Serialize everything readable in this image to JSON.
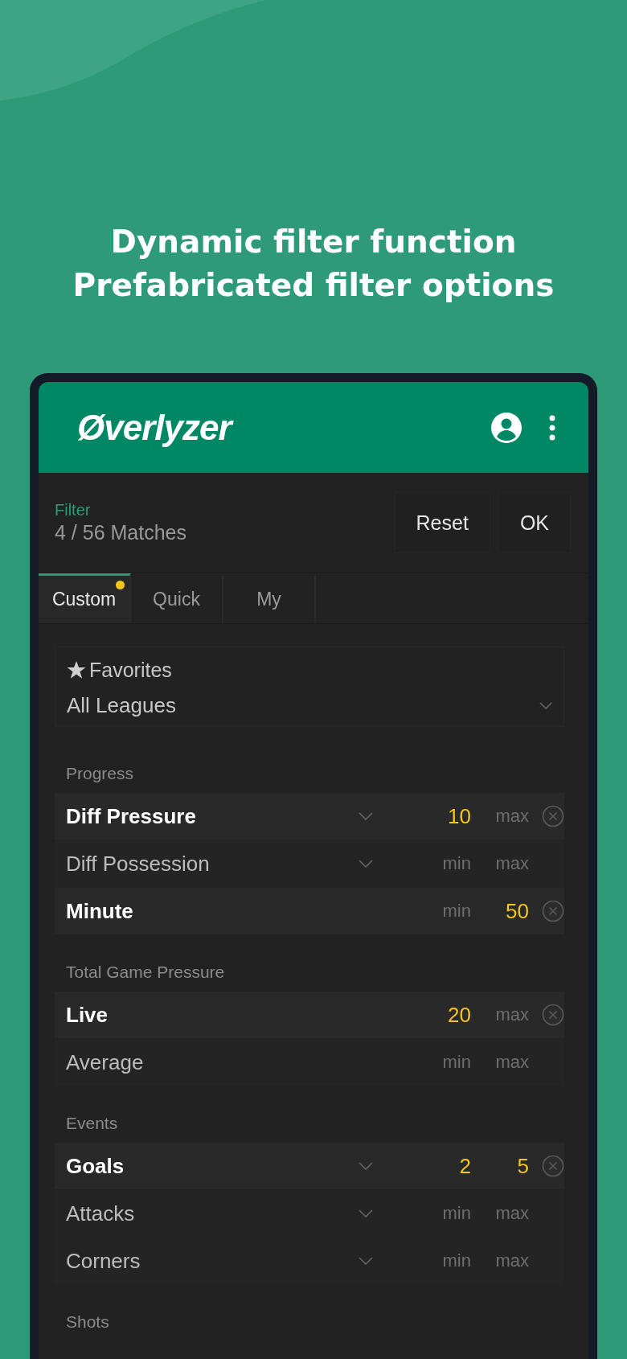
{
  "headline": [
    "Dynamic filter function",
    "Prefabricated filter options"
  ],
  "app_bar": {
    "logo": "Øverlyzer"
  },
  "filter": {
    "label": "Filter",
    "count": "4 / 56 Matches",
    "buttons": [
      "Reset",
      "OK"
    ]
  },
  "tabs": [
    {
      "label": "Custom",
      "selected": true,
      "badge": true
    },
    {
      "label": "Quick",
      "selected": false,
      "badge": false
    },
    {
      "label": "My",
      "selected": false,
      "badge": false
    }
  ],
  "favorites": {
    "label": "Favorites",
    "value": "All Leagues"
  },
  "sections": [
    {
      "title": "Progress",
      "rows": [
        {
          "name": "Diff Pressure",
          "active": true,
          "dropdown": true,
          "min": {
            "value": "10"
          },
          "max": {
            "placeholder": "max"
          }
        },
        {
          "name": "Diff Possession",
          "active": false,
          "dropdown": true,
          "min": {
            "placeholder": "min"
          },
          "max": {
            "placeholder": "max"
          }
        },
        {
          "name": "Minute",
          "active": true,
          "dropdown": false,
          "min": {
            "placeholder": "min"
          },
          "max": {
            "value": "50"
          }
        }
      ]
    },
    {
      "title": "Total Game Pressure",
      "rows": [
        {
          "name": "Live",
          "active": true,
          "dropdown": false,
          "min": {
            "value": "20"
          },
          "max": {
            "placeholder": "max"
          }
        },
        {
          "name": "Average",
          "active": false,
          "dropdown": false,
          "min": {
            "placeholder": "min"
          },
          "max": {
            "placeholder": "max"
          }
        }
      ]
    },
    {
      "title": "Events",
      "rows": [
        {
          "name": "Goals",
          "active": true,
          "dropdown": true,
          "min": {
            "value": "2"
          },
          "max": {
            "value": "5"
          }
        },
        {
          "name": "Attacks",
          "active": false,
          "dropdown": true,
          "min": {
            "placeholder": "min"
          },
          "max": {
            "placeholder": "max"
          }
        },
        {
          "name": "Corners",
          "active": false,
          "dropdown": true,
          "min": {
            "placeholder": "min"
          },
          "max": {
            "placeholder": "max"
          }
        }
      ]
    },
    {
      "title": "Shots"
    }
  ]
}
